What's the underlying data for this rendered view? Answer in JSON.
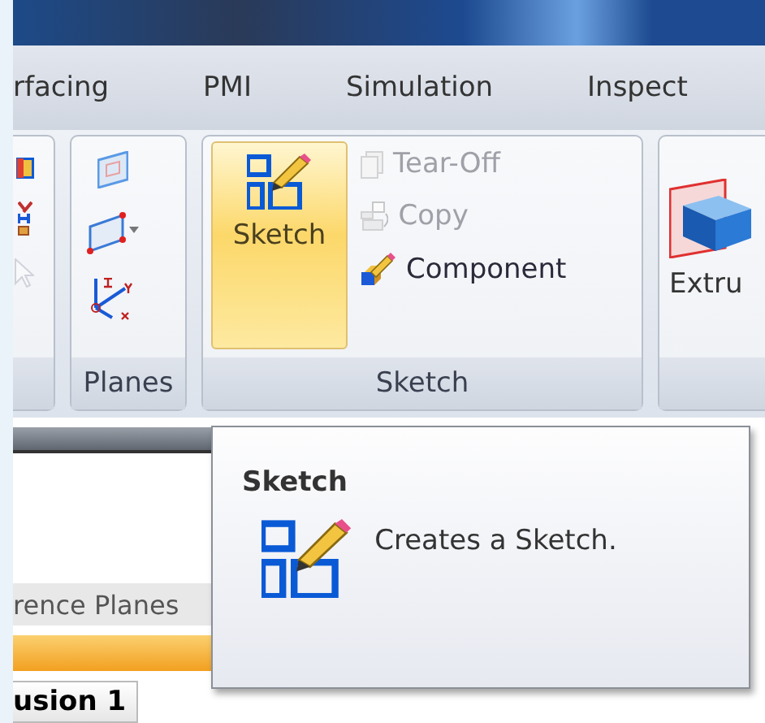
{
  "tabs": [
    {
      "label": "rfacing"
    },
    {
      "label": "PMI"
    },
    {
      "label": "Simulation"
    },
    {
      "label": "Inspect"
    }
  ],
  "ribbon": {
    "groups": [
      {
        "kind": "icons",
        "buttons": [
          {
            "disabled": false
          },
          {
            "disabled": false
          },
          {
            "disabled": true
          }
        ]
      },
      {
        "kind": "icons",
        "label": "Planes",
        "buttons": [
          {
            "disabled": false
          },
          {
            "disabled": false
          },
          {
            "disabled": false
          }
        ]
      },
      {
        "kind": "mixed",
        "label": "Sketch",
        "large": {
          "label": "Sketch",
          "highlighted": true
        },
        "buttons": [
          {
            "label": "Tear-Off",
            "disabled": true
          },
          {
            "label": "Copy",
            "disabled": true
          },
          {
            "label": "Component",
            "disabled": false
          }
        ]
      },
      {
        "kind": "large",
        "large": {
          "label": "Extru",
          "highlighted": false
        }
      }
    ]
  },
  "tooltip": {
    "title": "Sketch",
    "text": "Creates a Sketch."
  },
  "panel": {
    "tab": "rence Planes",
    "feature": "usion 1"
  }
}
